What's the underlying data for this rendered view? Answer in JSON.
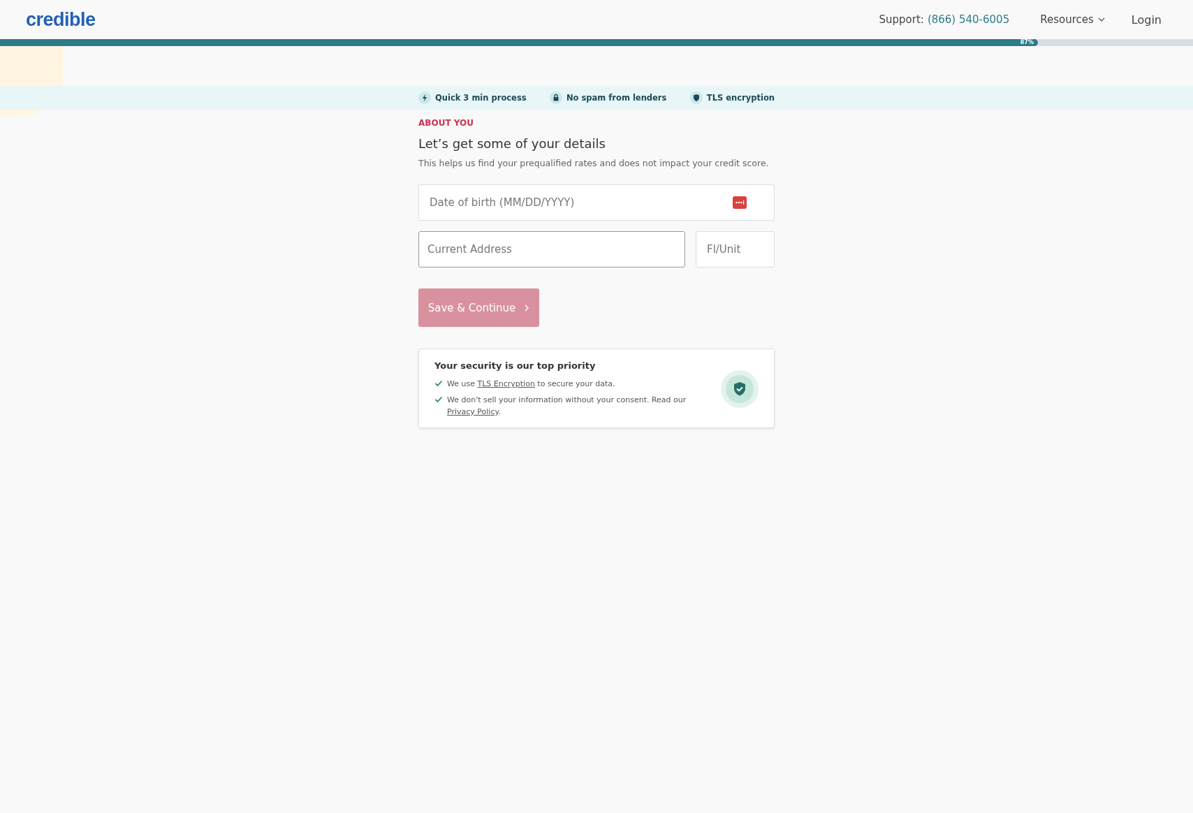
{
  "header": {
    "logo": "credible",
    "support_label": "Support:",
    "support_phone": "(866) 540-6005",
    "resources": "Resources",
    "login": "Login"
  },
  "progress": {
    "level": 0.87,
    "label": "87%"
  },
  "trust_items": [
    {
      "kind": "bolt",
      "label": "Quick 3 min process"
    },
    {
      "kind": "lock",
      "label": "No spam from lenders"
    },
    {
      "kind": "shield",
      "label": "TLS encryption"
    }
  ],
  "form": {
    "eyebrow": "ABOUT YOU",
    "title": "Let’s get some of your details",
    "subtitle": "This helps us find your prequalified rates and does not impact your credit score.",
    "dob": {
      "placeholder": "Date of birth (MM/DD/YYYY)"
    },
    "address": {
      "placeholder": "Current Address"
    },
    "unit": {
      "placeholder": "Fl/Unit"
    },
    "submit": {
      "label": "Save & Continue",
      "disabled": true
    }
  },
  "security": {
    "title": "Your security is our top priority",
    "items": [
      [
        {
          "kind": "text",
          "text": "We use "
        },
        {
          "kind": "link",
          "text": "TLS Encryption"
        },
        {
          "kind": "text",
          "text": " to secure your data."
        }
      ],
      [
        {
          "kind": "text",
          "text": "We don't sell your information without your consent. Read our "
        },
        {
          "kind": "link",
          "text": "Privacy Policy"
        },
        {
          "kind": "text",
          "text": "."
        }
      ]
    ]
  }
}
